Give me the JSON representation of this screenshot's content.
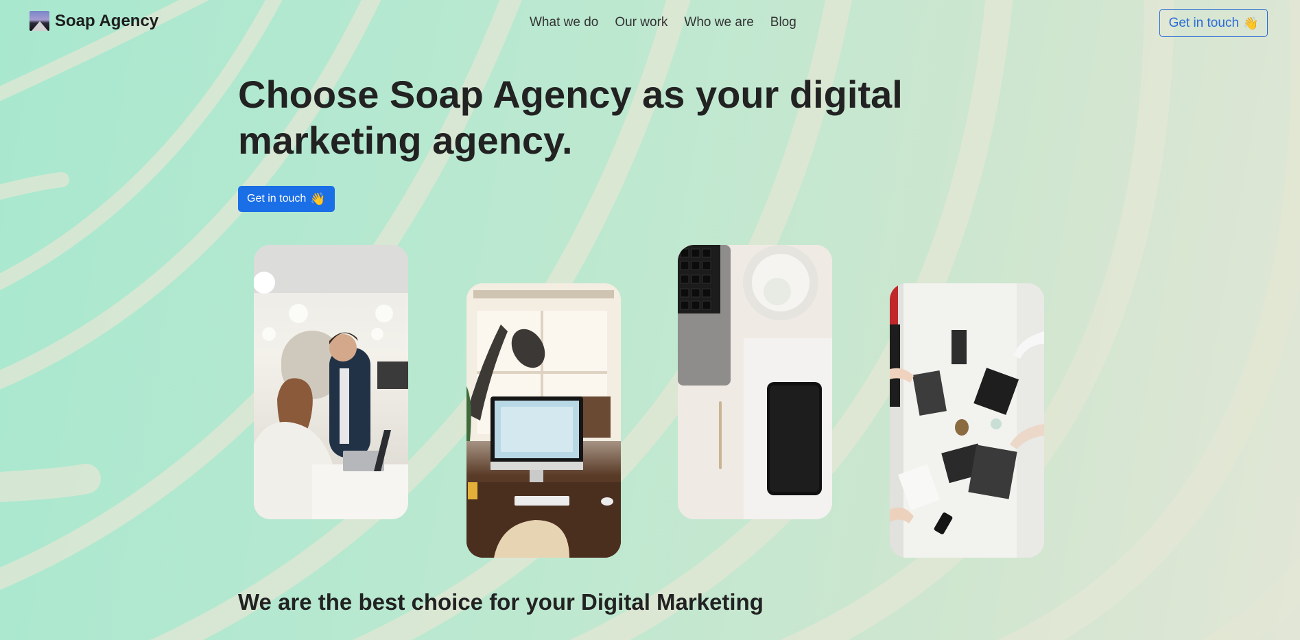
{
  "header": {
    "brand_name": "Soap Agency",
    "nav": [
      "What we do",
      "Our work",
      "Who we are",
      "Blog"
    ],
    "cta_label": "Get in touch",
    "cta_emoji": "👋"
  },
  "hero": {
    "title": "Choose Soap Agency as your digital marketing agency.",
    "cta_label": "Get in touch",
    "cta_emoji": "👋"
  },
  "gallery": [
    {
      "name": "office-collaboration-photo"
    },
    {
      "name": "desk-computer-photo"
    },
    {
      "name": "laptop-phone-photo"
    },
    {
      "name": "team-meeting-photo"
    }
  ],
  "section": {
    "title": "We are the best choice for your Digital Marketing"
  },
  "colors": {
    "accent": "#1a6ee6",
    "background": "#bde8d0"
  }
}
